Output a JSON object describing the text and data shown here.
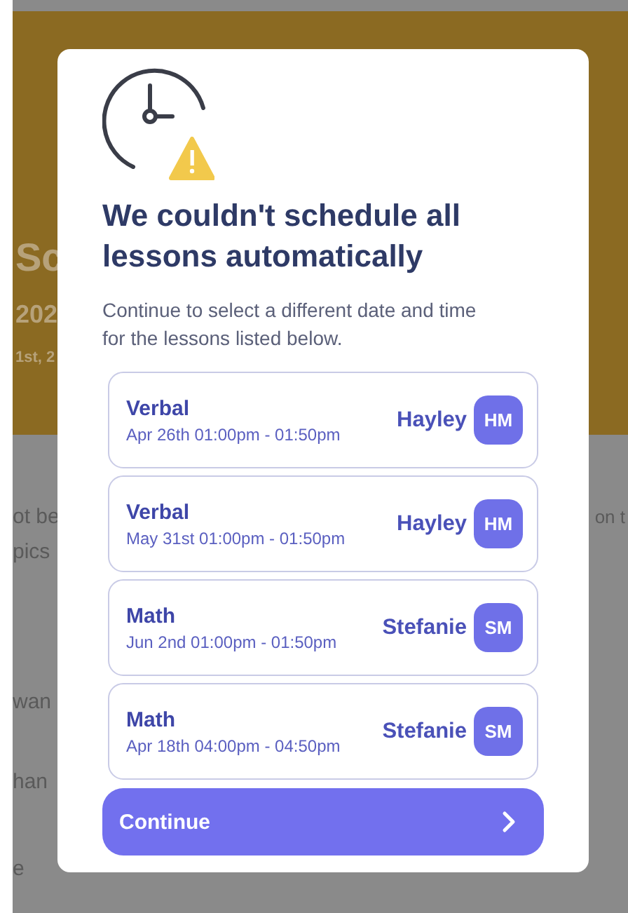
{
  "background_page": {
    "header_fragments": [
      "Sc",
      "202",
      "1st, 2"
    ],
    "body_fragments_left": [
      "ot be",
      "pics",
      "wan",
      "han",
      "e"
    ],
    "body_fragment_right": "on t"
  },
  "dialog": {
    "title": "We couldn't schedule all lessons automatically",
    "message": "Continue to select a different date and time for the lessons listed below.",
    "lessons": [
      {
        "subject": "Verbal",
        "time": "Apr 26th 01:00pm - 01:50pm",
        "tutor": "Hayley",
        "initials": "HM"
      },
      {
        "subject": "Verbal",
        "time": "May 31st 01:00pm - 01:50pm",
        "tutor": "Hayley",
        "initials": "HM"
      },
      {
        "subject": "Math",
        "time": "Jun 2nd 01:00pm - 01:50pm",
        "tutor": "Stefanie",
        "initials": "SM"
      },
      {
        "subject": "Math",
        "time": "Apr 18th 04:00pm - 04:50pm",
        "tutor": "Stefanie",
        "initials": "SM"
      }
    ],
    "button": "Continue"
  }
}
